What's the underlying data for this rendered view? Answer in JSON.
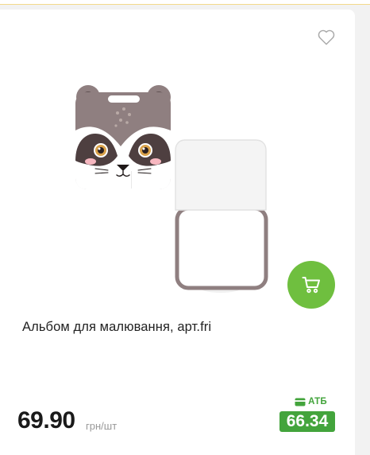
{
  "product": {
    "title": "Альбом для малювання, арт.fri",
    "price": "69.90",
    "unit": "грн/шт",
    "card_brand": "АТБ",
    "card_price": "66.34"
  },
  "icons": {
    "favorite": "heart-outline-icon",
    "cart": "shopping-cart-icon",
    "card": "loyalty-card-icon"
  },
  "colors": {
    "cart_button": "#6fbf3f",
    "promo_green": "#43a43c",
    "price": "#1a1a1a"
  }
}
